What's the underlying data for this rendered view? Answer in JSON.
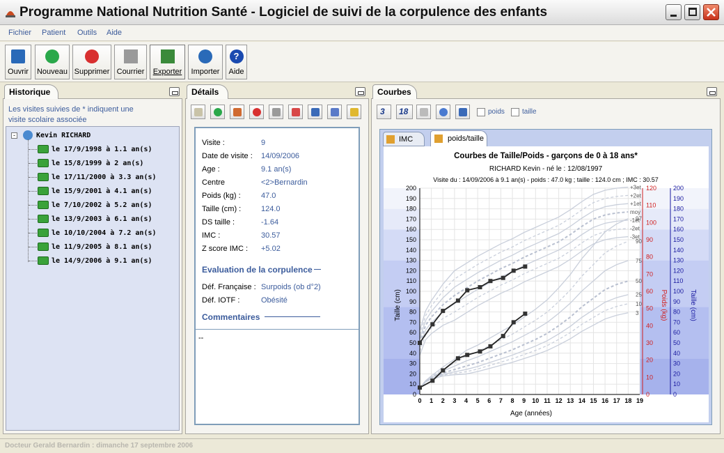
{
  "window": {
    "title": "Programme National Nutrition Santé - Logiciel de suivi de la corpulence des enfants"
  },
  "menu": [
    "Fichier",
    "Patient",
    "Outils",
    "Aide"
  ],
  "toolbar": [
    {
      "label": "Ouvrir",
      "icon": "folder-open-icon",
      "color": "#2a6ab8"
    },
    {
      "label": "Nouveau",
      "icon": "new-patient-icon",
      "color": "#2aa84a"
    },
    {
      "label": "Supprimer",
      "icon": "delete-patient-icon",
      "color": "#d83030"
    },
    {
      "label": "Courrier",
      "icon": "letter-icon",
      "color": "#7a7a7a"
    },
    {
      "label": "Exporter",
      "icon": "export-icon",
      "color": "#3a8a3a"
    },
    {
      "label": "Importer",
      "icon": "import-icon",
      "color": "#2a6ab8"
    },
    {
      "label": "Aide",
      "icon": "help-icon",
      "color": "#1a4ab0"
    }
  ],
  "historique": {
    "tab": "Historique",
    "info": "Les visites suivies de * indiquent une visite scolaire associée",
    "patient": "Kevin RICHARD",
    "visits": [
      "le 17/9/1998 à 1.1 an(s)",
      "le 15/8/1999 à 2 an(s)",
      "le 17/11/2000 à 3.3 an(s)",
      "le 15/9/2001 à 4.1 an(s)",
      "le 7/10/2002 à 5.2 an(s)",
      "le 13/9/2003 à 6.1 an(s)",
      "le 10/10/2004 à 7.2 an(s)",
      "le 11/9/2005 à 8.1 an(s)",
      "le 14/9/2006 à 9.1 an(s)"
    ]
  },
  "details": {
    "tab": "Détails",
    "fields": [
      {
        "label": "Visite :",
        "value": "9"
      },
      {
        "label": "Date de visite :",
        "value": "14/09/2006"
      },
      {
        "label": "Age :",
        "value": "9.1 an(s)"
      },
      {
        "label": "Centre",
        "value": "<2>Bernardin"
      },
      {
        "label": "Poids (kg) :",
        "value": "47.0"
      },
      {
        "label": "Taille (cm) :",
        "value": "124.0"
      },
      {
        "label": "DS taille :",
        "value": "-1.64"
      },
      {
        "label": "IMC :",
        "value": "30.57"
      },
      {
        "label": "Z score IMC :",
        "value": "+5.02"
      }
    ],
    "eval_title": "Evaluation de la corpulence",
    "eval": [
      {
        "label": "Déf. Française :",
        "value": "Surpoids (ob d°2)"
      },
      {
        "label": "Déf. IOTF :",
        "value": "Obésité"
      }
    ],
    "comments_title": "Commentaires",
    "comments": "--"
  },
  "courbes": {
    "tab": "Courbes",
    "toolbar_labels": [
      "3",
      "18"
    ],
    "chk_poids": "poids",
    "chk_taille": "taille",
    "subtabs": [
      "IMC",
      "poids/taille"
    ],
    "active_subtab": "poids/taille"
  },
  "chart_data": {
    "type": "line",
    "title": "Courbes de Taille/Poids - garçons de 0 à 18 ans*",
    "subtitle": "RICHARD Kevin - né le : 12/08/1997",
    "info": "Visite du : 14/09/2006 à 9.1 an(s) - poids : 47.0 kg ; taille : 124.0 cm ; IMC : 30.57",
    "xlabel": "Age (années)",
    "ylabel_left": "Taille (cm)",
    "ylabel_right_poids": "Poids (kg)",
    "ylabel_right_taille": "Taille (cm)",
    "xlim": [
      0,
      19
    ],
    "ylim_taille": [
      0,
      200
    ],
    "ylim_poids": [
      0,
      120
    ],
    "taille_percentile_labels": [
      "+3et",
      "+2et",
      "+1et",
      "moy",
      "-1et",
      "-2et",
      "-3et"
    ],
    "poids_percentile_labels": [
      "97",
      "90",
      "75",
      "50",
      "25",
      "10",
      "3"
    ],
    "series": [
      {
        "name": "taille",
        "x": [
          0,
          1.1,
          2,
          3.3,
          4.1,
          5.2,
          6.1,
          7.2,
          8.1,
          9.1
        ],
        "values": [
          50,
          68,
          81,
          91,
          101,
          104,
          110,
          113,
          120,
          124
        ]
      },
      {
        "name": "poids",
        "x": [
          0,
          1.1,
          2,
          3.3,
          4.1,
          5.2,
          6.1,
          7.2,
          8.1,
          9.1
        ],
        "values": [
          4,
          8,
          14,
          21,
          23,
          25,
          28,
          34,
          42,
          47
        ]
      }
    ]
  },
  "status": "Docteur Gerald Bernardin : dimanche 17 septembre 2006"
}
